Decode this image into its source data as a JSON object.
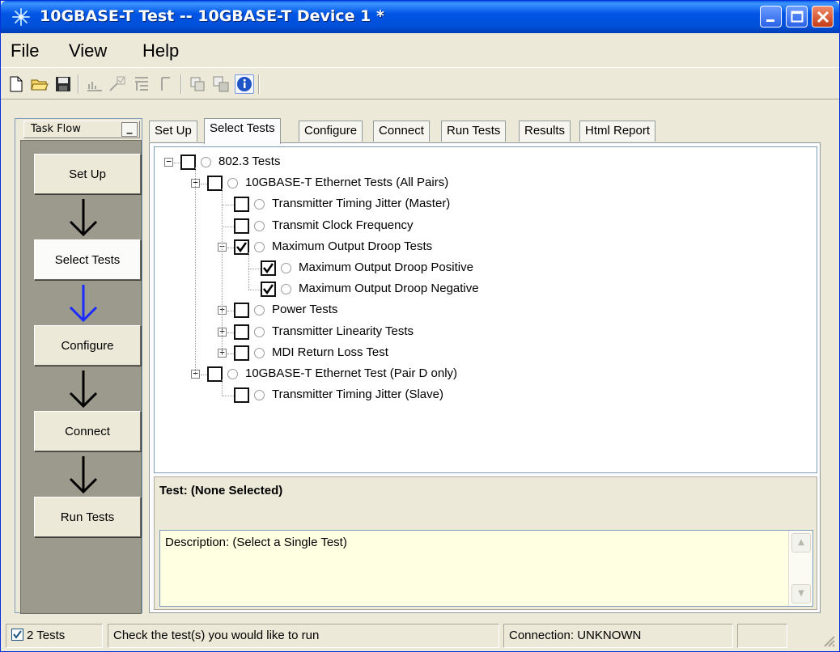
{
  "window": {
    "title": "10GBASE-T Test -- 10GBASE-T Device 1 *",
    "accent_color": "#0054e3",
    "close_color": "#c43c16"
  },
  "menu": {
    "items": [
      "File",
      "View",
      "Help"
    ]
  },
  "toolbar": {
    "icons": [
      "new-document-icon",
      "open-folder-icon",
      "save-disk-icon",
      "chart-icon",
      "check-arrow-icon",
      "list-icon",
      "bracket-icon",
      "copy-icon",
      "duplicate-icon",
      "info-icon"
    ]
  },
  "taskflow": {
    "title": "Task Flow",
    "minimize": "_",
    "steps": [
      {
        "label": "Set Up"
      },
      {
        "label": "Select Tests"
      },
      {
        "label": "Configure"
      },
      {
        "label": "Connect"
      },
      {
        "label": "Run Tests"
      }
    ],
    "current_step": "Select Tests",
    "arrow_color": "#000000",
    "current_arrow_color": "#1a2cff"
  },
  "tabs": [
    "Set Up",
    "Select Tests",
    "Configure",
    "Connect",
    "Run Tests",
    "Results",
    "Html Report"
  ],
  "active_tab": "Select Tests",
  "tree": [
    {
      "label": "802.3 Tests",
      "level": 0,
      "expander": "-",
      "checked": false
    },
    {
      "label": "10GBASE-T Ethernet Tests (All Pairs)",
      "level": 1,
      "expander": "-",
      "checked": false
    },
    {
      "label": "Transmitter Timing Jitter (Master)",
      "level": 2,
      "expander": "",
      "checked": false
    },
    {
      "label": "Transmit Clock Frequency",
      "level": 2,
      "expander": "",
      "checked": false
    },
    {
      "label": "Maximum Output Droop Tests",
      "level": 2,
      "expander": "-",
      "checked": true
    },
    {
      "label": "Maximum Output Droop Positive",
      "level": 3,
      "expander": "",
      "checked": true
    },
    {
      "label": "Maximum Output Droop Negative",
      "level": 3,
      "expander": "",
      "checked": true
    },
    {
      "label": "Power Tests",
      "level": 2,
      "expander": "+",
      "checked": false
    },
    {
      "label": "Transmitter Linearity Tests",
      "level": 2,
      "expander": "+",
      "checked": false
    },
    {
      "label": "MDI Return Loss Test",
      "level": 2,
      "expander": "+",
      "checked": false
    },
    {
      "label": "10GBASE-T Ethernet Test (Pair D only)",
      "level": 1,
      "expander": "-",
      "checked": false
    },
    {
      "label": "Transmitter Timing Jitter (Slave)",
      "level": 2,
      "expander": "",
      "checked": false
    }
  ],
  "details": {
    "test_label": "Test: (None Selected)",
    "description": "Description: (Select a Single Test)"
  },
  "status": {
    "test_count": "2 Tests",
    "test_count_checked": true,
    "message": "Check the test(s) you would like to run",
    "connection": "Connection: UNKNOWN"
  }
}
